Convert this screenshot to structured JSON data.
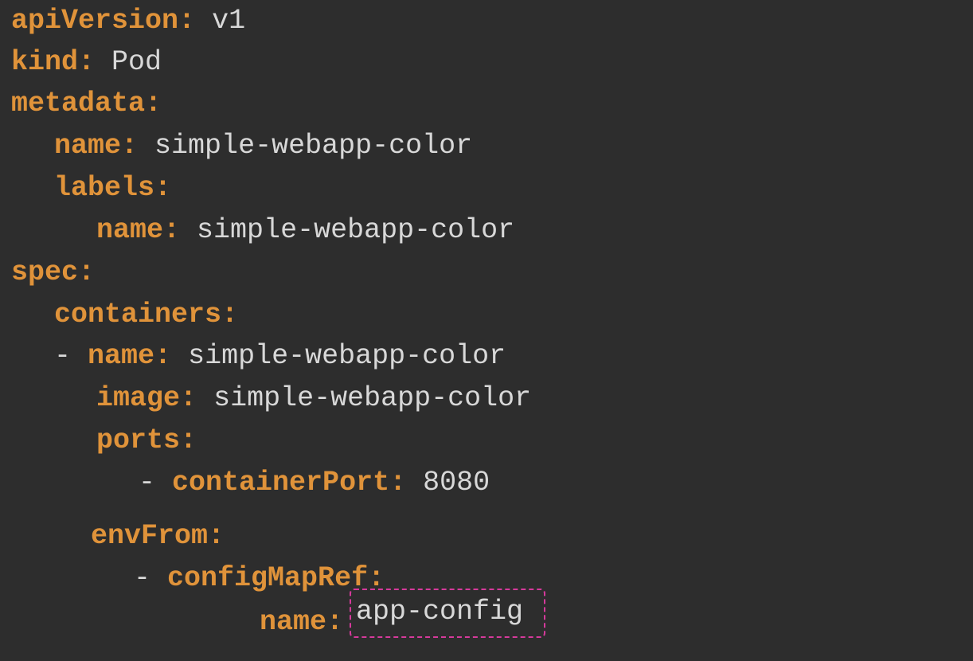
{
  "yaml": {
    "l1": {
      "key": "apiVersion",
      "colon": ":",
      "value": "v1"
    },
    "l2": {
      "key": "kind",
      "colon": ":",
      "value": "Pod"
    },
    "l3": {
      "key": "metadata",
      "colon": ":"
    },
    "l4": {
      "key": "name",
      "colon": ":",
      "value": "simple-webapp-color"
    },
    "l5": {
      "key": "labels",
      "colon": ":"
    },
    "l6": {
      "key": "name",
      "colon": ":",
      "value": "simple-webapp-color"
    },
    "l7": {
      "key": "spec",
      "colon": ":"
    },
    "l8": {
      "key": "containers",
      "colon": ":"
    },
    "l9": {
      "dash": "-",
      "key": "name",
      "colon": ":",
      "value": "simple-webapp-color"
    },
    "l10": {
      "key": "image",
      "colon": ":",
      "value": "simple-webapp-color"
    },
    "l11": {
      "key": "ports",
      "colon": ":"
    },
    "l12": {
      "dash": "-",
      "key": "containerPort",
      "colon": ":",
      "value": "8080"
    },
    "l13": {
      "key": "envFrom",
      "colon": ":"
    },
    "l14": {
      "dash": "-",
      "key": "configMapRef",
      "colon": ":"
    },
    "l15": {
      "key": "name",
      "colon": ":",
      "value": "app-config"
    }
  },
  "colors": {
    "background": "#2d2d2d",
    "key": "#e0933a",
    "value": "#d8d8d8",
    "highlight_border": "#d63a9c"
  }
}
